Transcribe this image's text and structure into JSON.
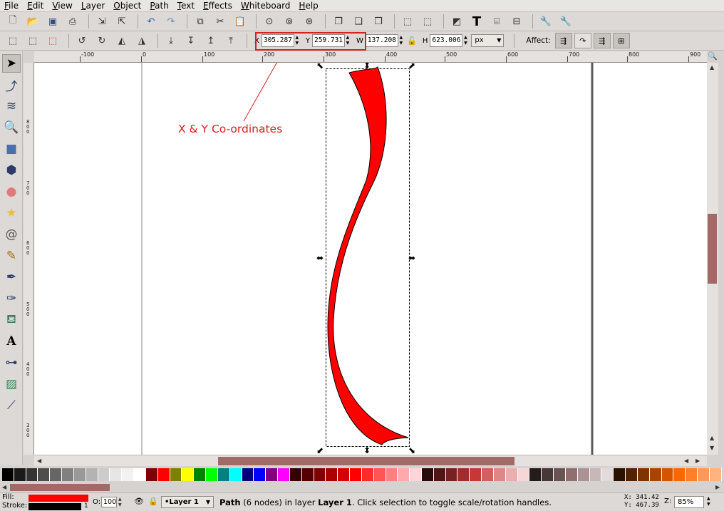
{
  "menu": [
    "File",
    "Edit",
    "View",
    "Layer",
    "Object",
    "Path",
    "Text",
    "Effects",
    "Whiteboard",
    "Help"
  ],
  "toolbar2": {
    "x_label": "X",
    "x_value": "305.287",
    "y_label": "Y",
    "y_value": "259.731",
    "w_label": "W",
    "w_value": "137.208",
    "h_label": "H",
    "h_value": "623.006",
    "unit": "px",
    "affect_label": "Affect:"
  },
  "ruler": {
    "h_ticks": [
      "-100",
      "0",
      "100",
      "200",
      "300",
      "400",
      "500",
      "600",
      "700",
      "800",
      "900"
    ],
    "v_ticks": [
      "800",
      "700",
      "600",
      "500",
      "400",
      "300"
    ]
  },
  "annotation": {
    "text": "X & Y Co-ordinates",
    "color": "#d8201c"
  },
  "shape": {
    "fill": "#ff0000",
    "stroke": "#000000"
  },
  "palette": [
    "#000000",
    "#1a1a1a",
    "#333333",
    "#4d4d4d",
    "#666666",
    "#808080",
    "#999999",
    "#b3b3b3",
    "#cccccc",
    "#e6e6e6",
    "#f2f2f2",
    "#ffffff",
    "#800000",
    "#ff0000",
    "#808000",
    "#ffff00",
    "#008000",
    "#00ff00",
    "#008080",
    "#00ffff",
    "#000080",
    "#0000ff",
    "#800080",
    "#ff00ff",
    "#330000",
    "#550000",
    "#800000",
    "#aa0000",
    "#d40000",
    "#ff0000",
    "#ff2a2a",
    "#ff5555",
    "#ff8080",
    "#ffaaaa",
    "#ffd5d5",
    "#280b0b",
    "#501616",
    "#782121",
    "#a02c2c",
    "#c83737",
    "#d35f5f",
    "#de8787",
    "#e9afaf",
    "#f4d7d7",
    "#241c1c",
    "#483737",
    "#6c5353",
    "#916f6f",
    "#ac9393",
    "#c8b7b7",
    "#e3dbdb",
    "#2b1100",
    "#552200",
    "#803300",
    "#aa4400",
    "#d45500",
    "#ff6600",
    "#ff7f2a",
    "#ff9955",
    "#ffb380"
  ],
  "status": {
    "fill_label": "Fill:",
    "stroke_label": "Stroke:",
    "stroke_width": "1",
    "opacity_label": "O:",
    "opacity_value": "100",
    "layer": "•Layer 1",
    "msg_bold1": "Path",
    "msg_mid": " (6 nodes) in layer ",
    "msg_bold2": "Layer 1",
    "msg_end": ". Click selection to toggle scale/rotation handles.",
    "cursor_x_label": "X:",
    "cursor_x": "341.42",
    "cursor_y_label": "Y:",
    "cursor_y": "467.39",
    "zoom_label": "Z:",
    "zoom_value": "85%"
  }
}
